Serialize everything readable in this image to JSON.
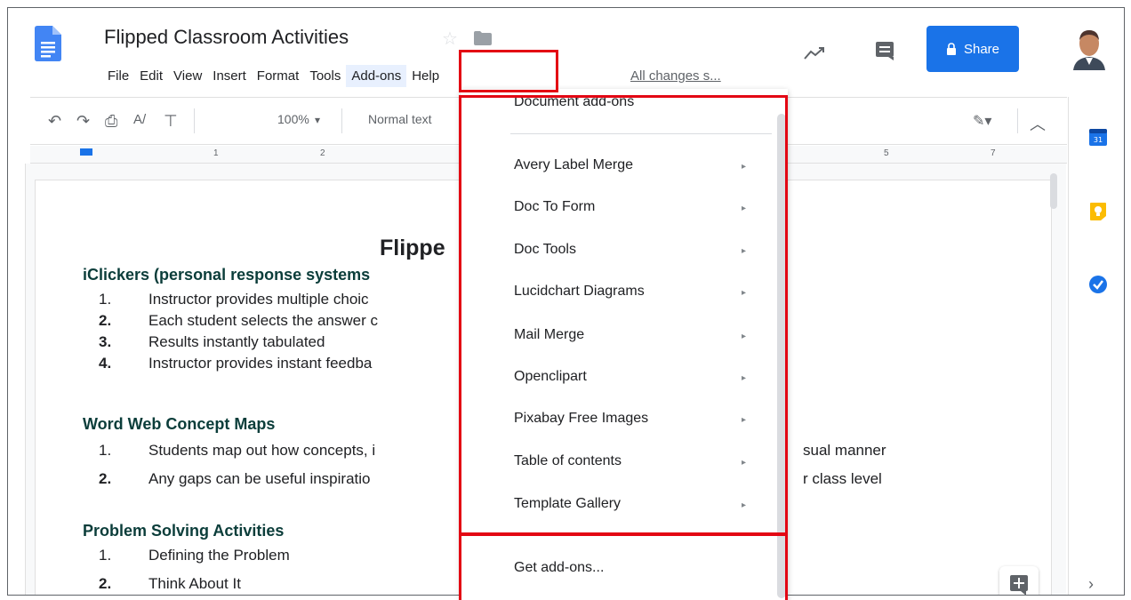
{
  "header": {
    "title": "Flipped Classroom Activities",
    "menu": [
      "File",
      "Edit",
      "View",
      "Insert",
      "Format",
      "Tools",
      "Add-ons",
      "Help"
    ],
    "active_menu": "Add-ons",
    "status": "All changes s...",
    "share_label": "Share"
  },
  "toolbar": {
    "zoom": "100%",
    "style": "Normal text"
  },
  "ruler": {
    "marks": [
      "1",
      "2",
      "5",
      "7"
    ]
  },
  "document": {
    "title": "Flippe",
    "sections": [
      {
        "heading": "iClickers (personal response systems",
        "items": [
          {
            "num": "1.",
            "text": "Instructor provides multiple choic"
          },
          {
            "num": "2.",
            "text": "Each student selects the answer c"
          },
          {
            "num": "3.",
            "text": "Results instantly tabulated"
          },
          {
            "num": "4.",
            "text": "Instructor provides instant feedba"
          }
        ]
      },
      {
        "heading": "Word Web Concept Maps",
        "items": [
          {
            "num": "1.",
            "text": "Students map out how concepts, i"
          },
          {
            "num": "2.",
            "text": "Any gaps can be useful inspiratio"
          }
        ]
      },
      {
        "heading": "Problem Solving Activities",
        "items": [
          {
            "num": "1.",
            "text": "Defining the Problem"
          },
          {
            "num": "2.",
            "text": "Think About It"
          }
        ]
      }
    ],
    "tail_1": "sual manner",
    "tail_2": "r class level"
  },
  "addons_menu": {
    "header_item": "Document add-ons",
    "items": [
      "Avery Label Merge",
      "Doc To Form",
      "Doc Tools",
      "Lucidchart Diagrams",
      "Mail Merge",
      "Openclipart",
      "Pixabay Free Images",
      "Table of contents",
      "Template Gallery"
    ],
    "get_addons": "Get add-ons..."
  },
  "colors": {
    "share_blue": "#1a73e8",
    "highlight_red": "#e30613",
    "heading_teal": "#0b3d3a"
  }
}
